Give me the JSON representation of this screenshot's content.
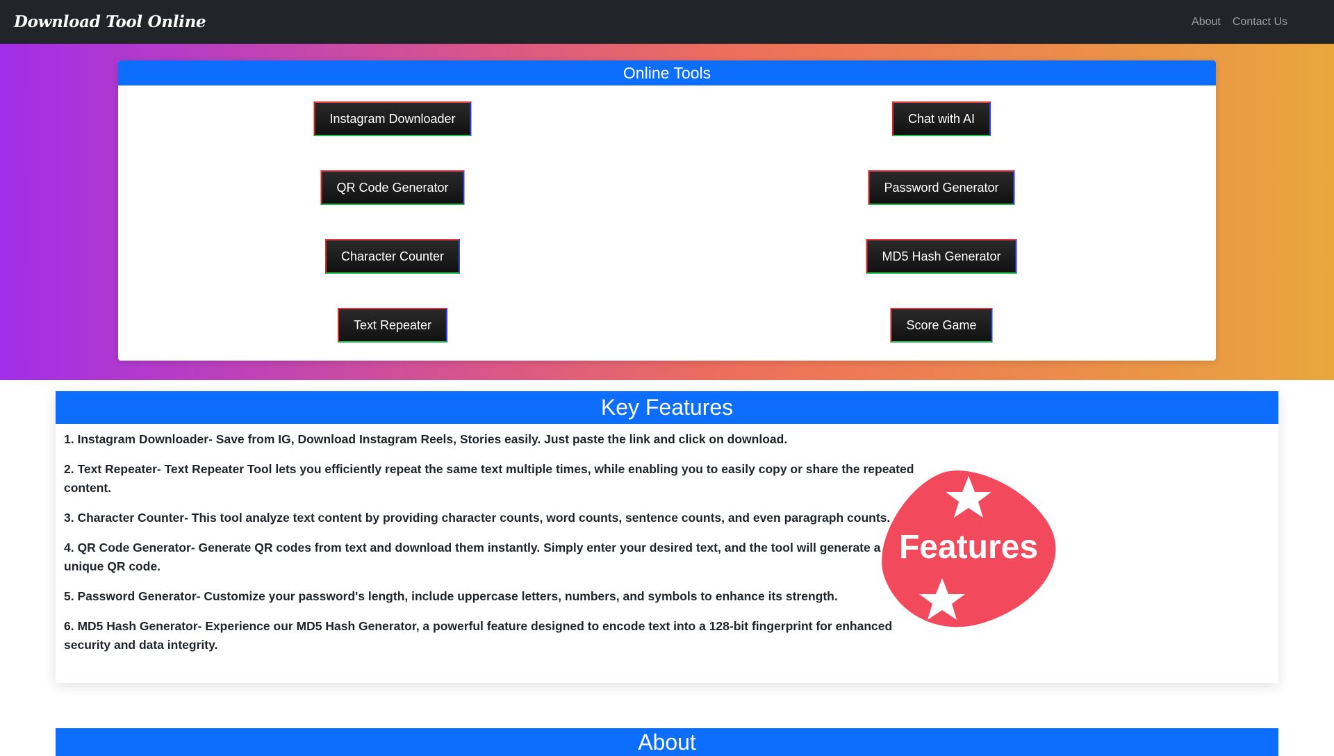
{
  "nav": {
    "brand": "Download Tool Online",
    "links": [
      "About",
      "Contact Us"
    ]
  },
  "tools": {
    "title": "Online Tools",
    "buttons": [
      "Instagram Downloader",
      "Chat with AI",
      "QR Code Generator",
      "Password Generator",
      "Character Counter",
      "MD5 Hash Generator",
      "Text Repeater",
      "Score Game"
    ]
  },
  "features": {
    "title": "Key Features",
    "items": [
      "1. Instagram Downloader- Save from IG, Download Instagram Reels, Stories easily. Just paste the link and click on download.",
      "2. Text Repeater- Text Repeater Tool lets you efficiently repeat the same text multiple times, while enabling you to easily copy or share the repeated content.",
      "3. Character Counter- This tool analyze text content by providing character counts, word counts, sentence counts, and even paragraph counts.",
      "4. QR Code Generator- Generate QR codes from text and download them instantly. Simply enter your desired text, and the tool will generate a unique QR code.",
      "5. Password Generator- Customize your password's length, include uppercase letters, numbers, and symbols to enhance its strength.",
      "6. MD5 Hash Generator- Experience our MD5 Hash Generator, a powerful feature designed to encode text into a 128-bit fingerprint for enhanced security and data integrity."
    ],
    "badge_text": "Features"
  },
  "about": {
    "title": "About"
  },
  "colors": {
    "navbar": "#212529",
    "header_blue": "#0d6efd",
    "badge_red": "#f2495c"
  }
}
